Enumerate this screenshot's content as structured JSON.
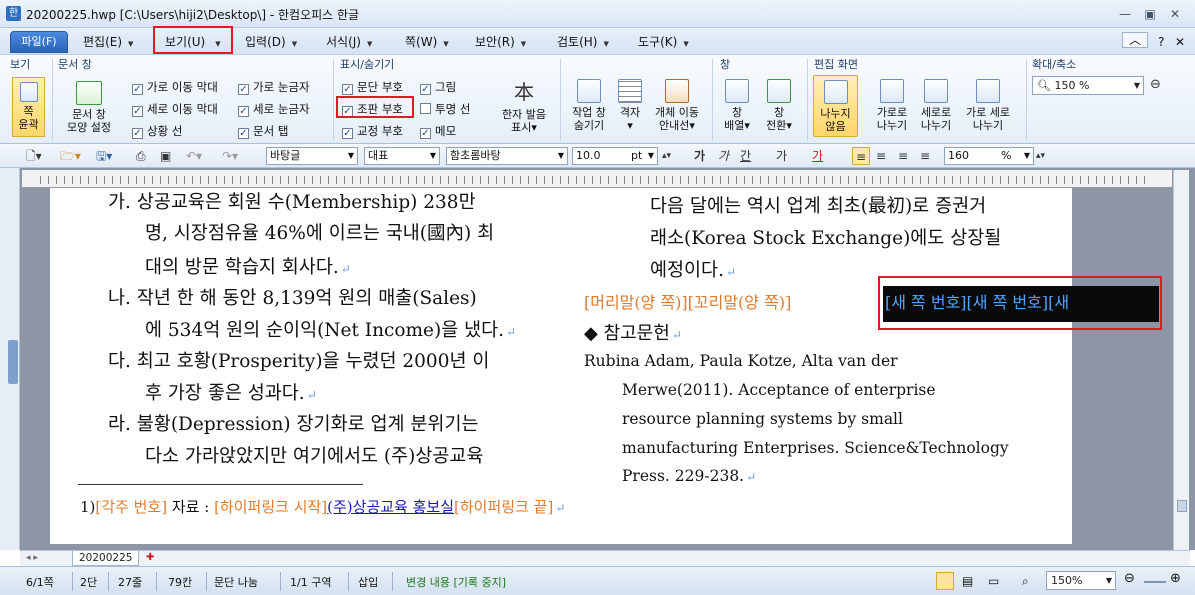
{
  "window": {
    "title": "20200225.hwp [C:\\Users\\hiji2\\Desktop\\] - 한컴오피스 한글",
    "controls": [
      "—",
      "▣",
      "✕"
    ]
  },
  "menubar": {
    "items": [
      {
        "label": "파일(F)"
      },
      {
        "label": "편집(E)"
      },
      {
        "label": "보기(U)"
      },
      {
        "label": "입력(D)"
      },
      {
        "label": "서식(J)"
      },
      {
        "label": "쪽(W)"
      },
      {
        "label": "보안(R)"
      },
      {
        "label": "검토(H)"
      },
      {
        "label": "도구(K)"
      }
    ],
    "right_icons": [
      "︿",
      "?",
      "✕"
    ]
  },
  "ribbon": {
    "groups": {
      "view": "보기",
      "doc_window": "문서 창",
      "show_hide": "표시/숨기기",
      "window": "창",
      "edit_screen": "편집 화면",
      "zoom": "확대/축소"
    },
    "page_fit": [
      "쪽",
      "윤곽"
    ],
    "doc_window_style": [
      "문서 창",
      "모양 설정"
    ],
    "checkboxes_col1": [
      {
        "label": "가로 이동 막대",
        "checked": true
      },
      {
        "label": "세로 이동 막대",
        "checked": true
      },
      {
        "label": "상황 선",
        "checked": true
      }
    ],
    "checkboxes_col2": [
      {
        "label": "가로 눈금자",
        "checked": true
      },
      {
        "label": "세로 눈금자",
        "checked": true
      },
      {
        "label": "문서 탭",
        "checked": true
      }
    ],
    "checkboxes_col3": [
      {
        "label": "문단 부호",
        "checked": true
      },
      {
        "label": "조판 부호",
        "checked": true
      },
      {
        "label": "교정 부호",
        "checked": true
      }
    ],
    "checkboxes_col4": [
      {
        "label": "그림",
        "checked": true
      },
      {
        "label": "투명 선",
        "checked": false
      },
      {
        "label": "메모",
        "checked": true
      }
    ],
    "hanja": [
      "한자 발음",
      "표시▾"
    ],
    "hanja_glyph": "本",
    "task_window": [
      "작업 창",
      "숨기기"
    ],
    "grid": [
      "격자",
      "▾"
    ],
    "object_guide": [
      "개체 이동",
      "안내선▾"
    ],
    "arrange": [
      "창",
      "배열▾"
    ],
    "switch": [
      "창",
      "전환▾"
    ],
    "no_split": [
      "나누지",
      "않음"
    ],
    "split_h": [
      "가로로",
      "나누기"
    ],
    "split_v": [
      "세로로",
      "나누기"
    ],
    "split_hv": [
      "가로 세로",
      "나누기"
    ],
    "zoom_value": "150 %"
  },
  "toolbar": {
    "style": "바탕글",
    "font_lang": "대표",
    "font": "함초롬바탕",
    "size": "10.0",
    "size_unit": "pt",
    "bold": "가",
    "italic": "가",
    "underline": "간",
    "strike": "가",
    "color": "가",
    "line_spacing": "160",
    "line_spacing_unit": "%"
  },
  "document": {
    "left_col": [
      {
        "marker": "가.",
        "text": "상공교육은  회원  수(Membership)  238만"
      },
      {
        "marker": "",
        "text": "명, 시장점유율 46%에 이르는 국내(國內) 최"
      },
      {
        "marker": "",
        "text": "대의 방문 학습지 회사다."
      },
      {
        "marker": "나.",
        "text": "작년 한 해 동안 8,139억 원의 매출(Sales)"
      },
      {
        "marker": "",
        "text": "에 534억 원의 순이익(Net Income)을 냈다."
      },
      {
        "marker": "다.",
        "text": "최고 호황(Prosperity)을 누렸던 2000년 이"
      },
      {
        "marker": "",
        "text": "후 가장 좋은 성과다."
      },
      {
        "marker": "라.",
        "text": "불황(Depression) 장기화로 업계 분위기는"
      },
      {
        "marker": "",
        "text": "다소 가라앉았지만 여기에서도 (주)상공교육"
      }
    ],
    "right_col": [
      "다음 달에는 역시 업계 최초(最初)로 증권거",
      "래소(Korea  Stock  Exchange)에도  상장될",
      "예정이다."
    ],
    "header_footer_codes": "[머리말(양 쪽)][꼬리말(양 쪽)]",
    "new_page_codes": "[새 쪽 번호][새 쪽 번호][새",
    "reference_heading": "◆ 참고문헌",
    "reference_lines": [
      "Rubina  Adam,  Paula  Kotze,  Alta  van  der",
      "Merwe(2011).  Acceptance  of  enterprise",
      "resource  planning  systems  by  small",
      "manufacturing Enterprises. Science&Technology",
      "Press. 229-238."
    ],
    "footnote": {
      "num": "1)",
      "code": "[각주 번호]",
      "label": "자료 : ",
      "link_start": "[하이퍼링크 시작]",
      "link_text": "(주)상공교육 홍보실",
      "link_end": "[하이퍼링크 끝]"
    }
  },
  "doc_tab": {
    "name": "20200225"
  },
  "status": {
    "page": "6/1쪽",
    "column": "2단",
    "line": "27줄",
    "col": "79칸",
    "split": "문단 나눔",
    "section": "1/1 구역",
    "insert": "삽입",
    "track": "변경 내용 [기록 중지]",
    "zoom": "150%"
  }
}
